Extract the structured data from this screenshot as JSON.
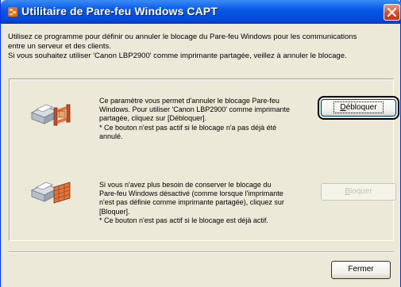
{
  "window": {
    "title": "Utilitaire de Pare-feu Windows CAPT",
    "title_icon": "capt-app-icon",
    "close_icon": "close-icon"
  },
  "intro": {
    "line1": "Utilisez ce programme pour définir ou annuler le blocage du Pare-feu Windows pour les communications",
    "line2": "entre un serveur et des clients.",
    "line3": "Si vous souhaitez utiliser 'Canon LBP2900' comme imprimante partagée, veillez à annuler le blocage."
  },
  "unblock": {
    "icon": "printer-firewall-open-icon",
    "desc_lines": [
      "Ce paramètre vous permet d'annuler le blocage Pare-feu",
      "Windows. Pour utiliser 'Canon LBP2900' comme imprimante",
      "partagée, cliquez sur [Débloquer].",
      "* Ce bouton n'est pas actif si le blocage n'a pas déjà été",
      "annulé."
    ],
    "button_label_first": "D",
    "button_label_rest": "ébloquer"
  },
  "block": {
    "icon": "printer-firewall-closed-icon",
    "desc_lines": [
      "Si vous n'avez plus besoin de conserver le blocage du",
      "Pare-feu Windows désactivé (comme lorsque l'imprimante",
      "n'est pas définie comme imprimante partagée), cliquez sur",
      "[Bloquer].",
      "* Ce bouton n'est pas actif si le blocage est déjà actif."
    ],
    "button_label_first": "B",
    "button_label_rest": "loquer"
  },
  "footer": {
    "close_label": "Fermer"
  }
}
